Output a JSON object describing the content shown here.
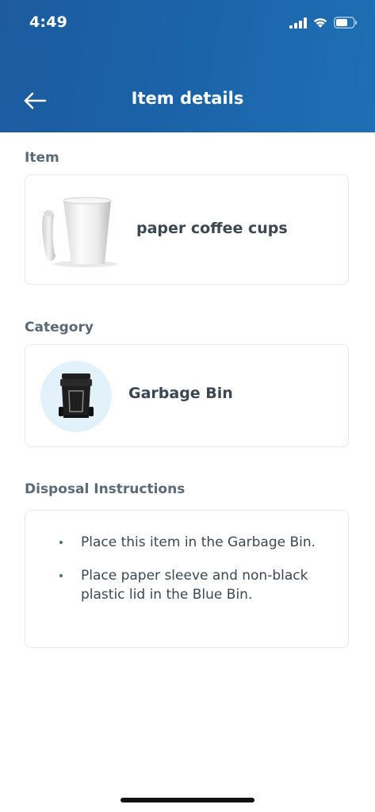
{
  "status_bar": {
    "time": "4:49",
    "icons": [
      "cellular-signal-icon",
      "wifi-icon",
      "battery-icon"
    ]
  },
  "header": {
    "back_icon": "arrow-left-icon",
    "title": "Item details",
    "background_color": "#1b62a8"
  },
  "item_section": {
    "label": "Item",
    "item_name": "paper coffee cups",
    "image": "paper-coffee-cup-image"
  },
  "category_section": {
    "label": "Category",
    "category_name": "Garbage Bin",
    "icon": "garbage-bin-icon",
    "icon_bg_color": "#e3f1fb"
  },
  "instructions_section": {
    "label": "Disposal Instructions",
    "items": [
      "Place this item in the Garbage Bin.",
      "Place paper sleeve and non-black plastic lid in the Blue Bin."
    ]
  }
}
